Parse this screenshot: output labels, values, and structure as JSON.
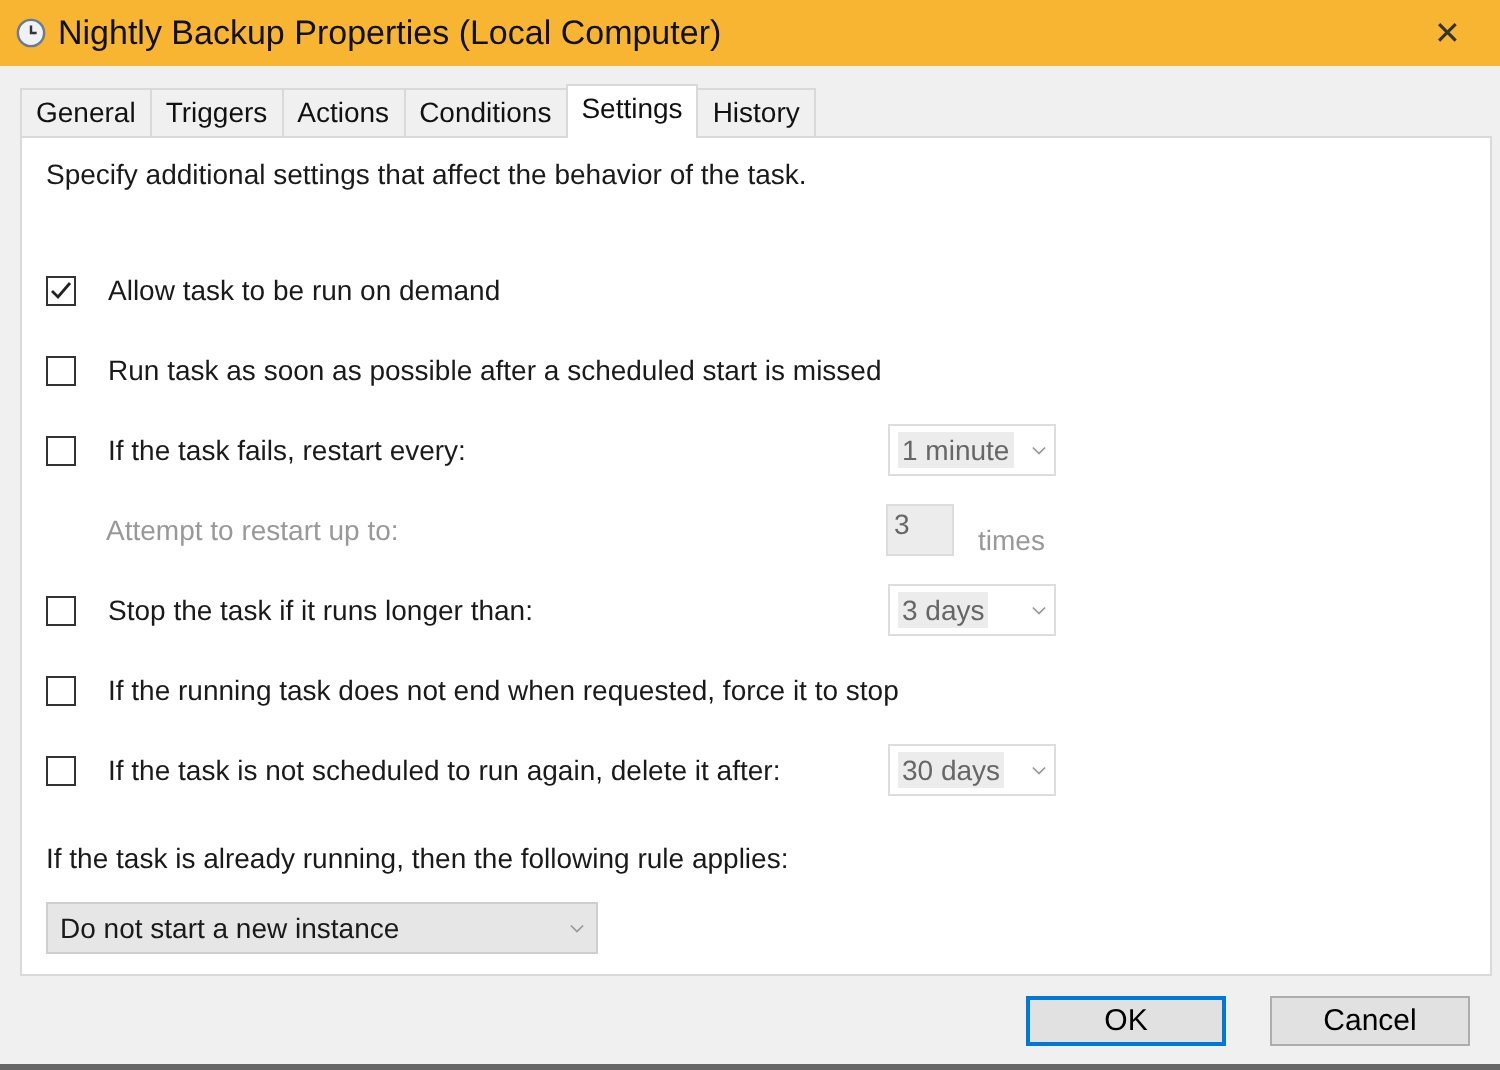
{
  "window": {
    "title": "Nightly Backup Properties (Local Computer)",
    "close": "✕"
  },
  "tabs": [
    {
      "label": "General",
      "selected": false
    },
    {
      "label": "Triggers",
      "selected": false
    },
    {
      "label": "Actions",
      "selected": false
    },
    {
      "label": "Conditions",
      "selected": false
    },
    {
      "label": "Settings",
      "selected": true
    },
    {
      "label": "History",
      "selected": false
    }
  ],
  "intro": "Specify additional settings that affect the behavior of the task.",
  "settings": [
    {
      "kind": "checkbox",
      "label": "Allow task to be run on demand",
      "checked": true
    },
    {
      "kind": "checkbox",
      "label": "Run task as soon as possible after a scheduled start is missed",
      "checked": false
    },
    {
      "kind": "checkbox",
      "label": "If the task fails, restart every:",
      "checked": false,
      "dropdown": {
        "value": "1 minute",
        "disabled": true
      }
    },
    {
      "kind": "number",
      "label": "Attempt to restart up to:",
      "disabled": true,
      "value": "3",
      "unit": "times"
    },
    {
      "kind": "checkbox",
      "label": "Stop the task if it runs longer than:",
      "checked": false,
      "dropdown": {
        "value": "3 days",
        "disabled": true
      }
    },
    {
      "kind": "checkbox",
      "label": "If the running task does not end when requested, force it to stop",
      "checked": false
    },
    {
      "kind": "checkbox",
      "label": "If the task is not scheduled to run again, delete it after:",
      "checked": false,
      "dropdown": {
        "value": "30 days",
        "disabled": true
      }
    }
  ],
  "rule": {
    "label": "If the task is already running, then the following rule applies:",
    "value": "Do not start a new instance"
  },
  "buttons": [
    {
      "label": "OK",
      "default": true
    },
    {
      "label": "Cancel",
      "default": false
    }
  ]
}
